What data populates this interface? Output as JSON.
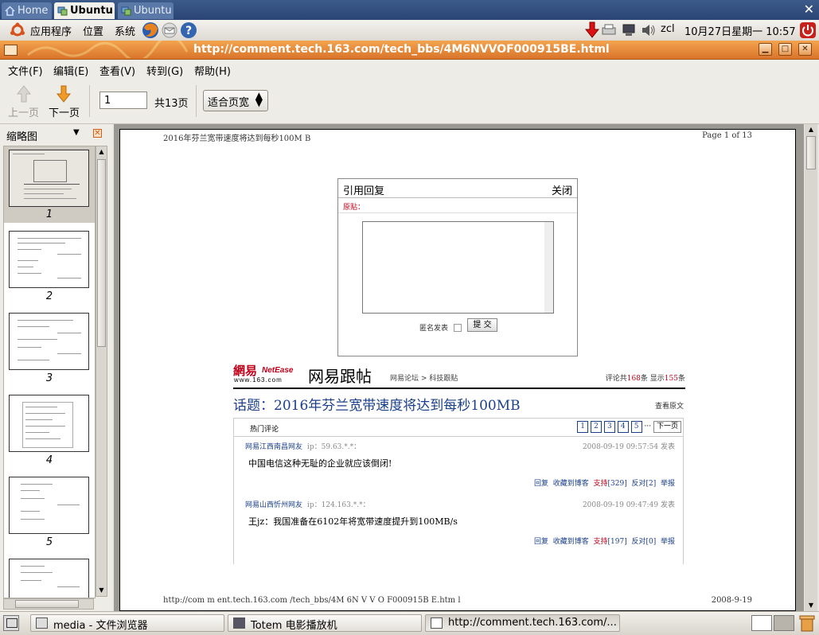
{
  "vm_tabs": [
    {
      "label": "Home"
    },
    {
      "label": "Ubuntu"
    },
    {
      "label": "Ubuntu"
    }
  ],
  "top_panel": {
    "applications": "应用程序",
    "places": "位置",
    "system": "系统",
    "user": "zcl",
    "datetime": "10月27日星期一 10:57"
  },
  "window": {
    "title": "http://comment.tech.163.com/tech_bbs/4M6NVVOF000915BE.html"
  },
  "menu": [
    "文件(F)",
    "编辑(E)",
    "查看(V)",
    "转到(G)",
    "帮助(H)"
  ],
  "toolbar": {
    "prev": "上一页",
    "next": "下一页",
    "page_value": "1",
    "page_total": "共13页",
    "zoom": "适合页宽"
  },
  "sidebar": {
    "title": "缩略图",
    "pages": [
      "1",
      "2",
      "3",
      "4",
      "5"
    ]
  },
  "document": {
    "header_left": "2016年芬兰宽带速度将达到每秒100M B",
    "header_right": "Page 1 of 13",
    "dialog": {
      "title": "引用回复",
      "close": "关闭",
      "orig_label": "原贴：",
      "anon_label": "匿名发表",
      "submit": "提 交"
    },
    "brand": {
      "logo_cn": "網易",
      "logo_en": "NetEase",
      "logo_url": "www.163.com",
      "name": "网易跟帖",
      "nav": "网易论坛 > 科技跟贴",
      "count_prefix": "评论共",
      "count_total": "168",
      "count_mid": "条  显示",
      "count_shown": "155",
      "count_suffix": "条"
    },
    "topic": "话题：2016年芬兰宽带速度将达到每秒100MB",
    "view_original": "查看原文",
    "hot_label": "热门评论",
    "pager": [
      "1",
      "2",
      "3",
      "4",
      "5"
    ],
    "pager_dots": "···",
    "pager_next": "下一页",
    "comments": [
      {
        "author": "网易江西南昌网友",
        "ip": "ip：59.63.*.*：",
        "time": "2008-09-19 09:57:54 发表",
        "text": "中国电信这种无耻的企业就应该倒闭!",
        "actions": {
          "reply": "回复",
          "fav": "收藏到博客",
          "support": "支持",
          "support_n": "[329]",
          "oppose": "反对",
          "oppose_n": "[2]",
          "report": "举报"
        }
      },
      {
        "author": "网易山西忻州网友",
        "ip": "ip：124.163.*.*：",
        "time": "2008-09-19 09:47:49 发表",
        "text": "王jz：我国准备在6102年将宽带速度提升到100MB/s",
        "actions": {
          "reply": "回复",
          "fav": "收藏到博客",
          "support": "支持",
          "support_n": "[197]",
          "oppose": "反对",
          "oppose_n": "[0]",
          "report": "举报"
        }
      }
    ],
    "footer_left": "http://com m ent.tech.163.com /tech_bbs/4M 6N V V O F000915B E.htm l",
    "footer_right": "2008-9-19"
  },
  "taskbar": [
    {
      "label": "media - 文件浏览器"
    },
    {
      "label": "Totem 电影播放机"
    },
    {
      "label": "http://comment.tech.163.com/..."
    }
  ],
  "colors": {
    "accent_orange": "#e08a3a",
    "netease_red": "#c0001a",
    "link_blue": "#1b3f8a"
  }
}
